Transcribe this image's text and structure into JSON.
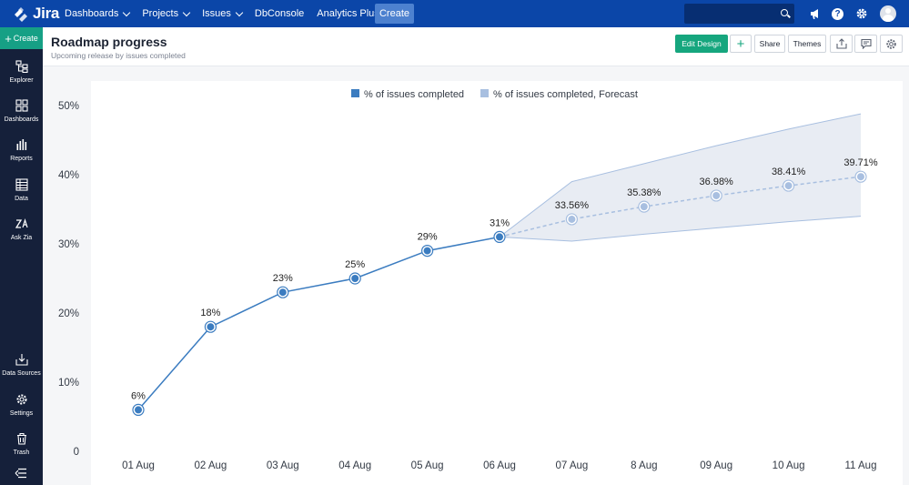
{
  "app": {
    "logo_text": "Jira",
    "nav": [
      "Dashboards",
      "Projects",
      "Issues",
      "DbConsole",
      "Analytics Plus"
    ],
    "nav_has_caret": [
      true,
      true,
      true,
      false,
      true
    ],
    "create_label": "Create"
  },
  "topbar_icons": [
    "search-icon",
    "announcement-icon",
    "help-icon",
    "settings-icon",
    "avatar"
  ],
  "sidebar": {
    "create_label": "Create",
    "items": [
      {
        "label": "Explorer",
        "icon": "explorer-icon"
      },
      {
        "label": "Dashboards",
        "icon": "dashboards-icon"
      },
      {
        "label": "Reports",
        "icon": "reports-icon"
      },
      {
        "label": "Data",
        "icon": "data-icon"
      },
      {
        "label": "Ask Zia",
        "icon": "zia-icon"
      },
      {
        "label": "Data Sources",
        "icon": "data-sources-icon"
      },
      {
        "label": "Settings",
        "icon": "settings-icon"
      },
      {
        "label": "Trash",
        "icon": "trash-icon"
      }
    ]
  },
  "header": {
    "title": "Roadmap progress",
    "subtitle": "Upcoming release by issues completed",
    "edit_label": "Edit Design",
    "add_label": "+",
    "share_label": "Share",
    "themes_label": "Themes"
  },
  "colors": {
    "brand": "#0b46a8",
    "sidebar": "#15203a",
    "accent_green": "#16a67e",
    "series_actual": "#3b7cc0",
    "series_forecast": "#a8bfe0",
    "forecast_band": "#e8ecf3"
  },
  "chart_data": {
    "type": "line",
    "title": "",
    "xlabel": "",
    "ylabel": "",
    "ylim": [
      0,
      50
    ],
    "y_ticks": [
      "0",
      "10%",
      "20%",
      "30%",
      "40%",
      "50%"
    ],
    "categories": [
      "01 Aug",
      "02 Aug",
      "03 Aug",
      "04 Aug",
      "05 Aug",
      "06 Aug",
      "07 Aug",
      "8 Aug",
      "09 Aug",
      "10 Aug",
      "11 Aug"
    ],
    "legend_position": "top-center",
    "grid": false,
    "series": [
      {
        "name": "% of issues completed",
        "values": [
          6,
          18,
          23,
          25,
          29,
          31,
          null,
          null,
          null,
          null,
          null
        ],
        "labels": [
          "6%",
          "18%",
          "23%",
          "25%",
          "29%",
          "31%",
          "",
          "",
          "",
          "",
          ""
        ]
      },
      {
        "name": "% of issues completed, Forecast",
        "values": [
          null,
          null,
          null,
          null,
          null,
          31,
          33.56,
          35.38,
          36.98,
          38.41,
          39.71
        ],
        "labels": [
          "",
          "",
          "",
          "",
          "",
          "",
          "33.56%",
          "35.38%",
          "36.98%",
          "38.41%",
          "39.71%"
        ],
        "upper": [
          null,
          null,
          null,
          null,
          null,
          31,
          39,
          41.6,
          44.2,
          46.6,
          48.8
        ],
        "lower": [
          null,
          null,
          null,
          null,
          null,
          31,
          30.4,
          31.4,
          32.3,
          33.2,
          34
        ]
      }
    ]
  }
}
